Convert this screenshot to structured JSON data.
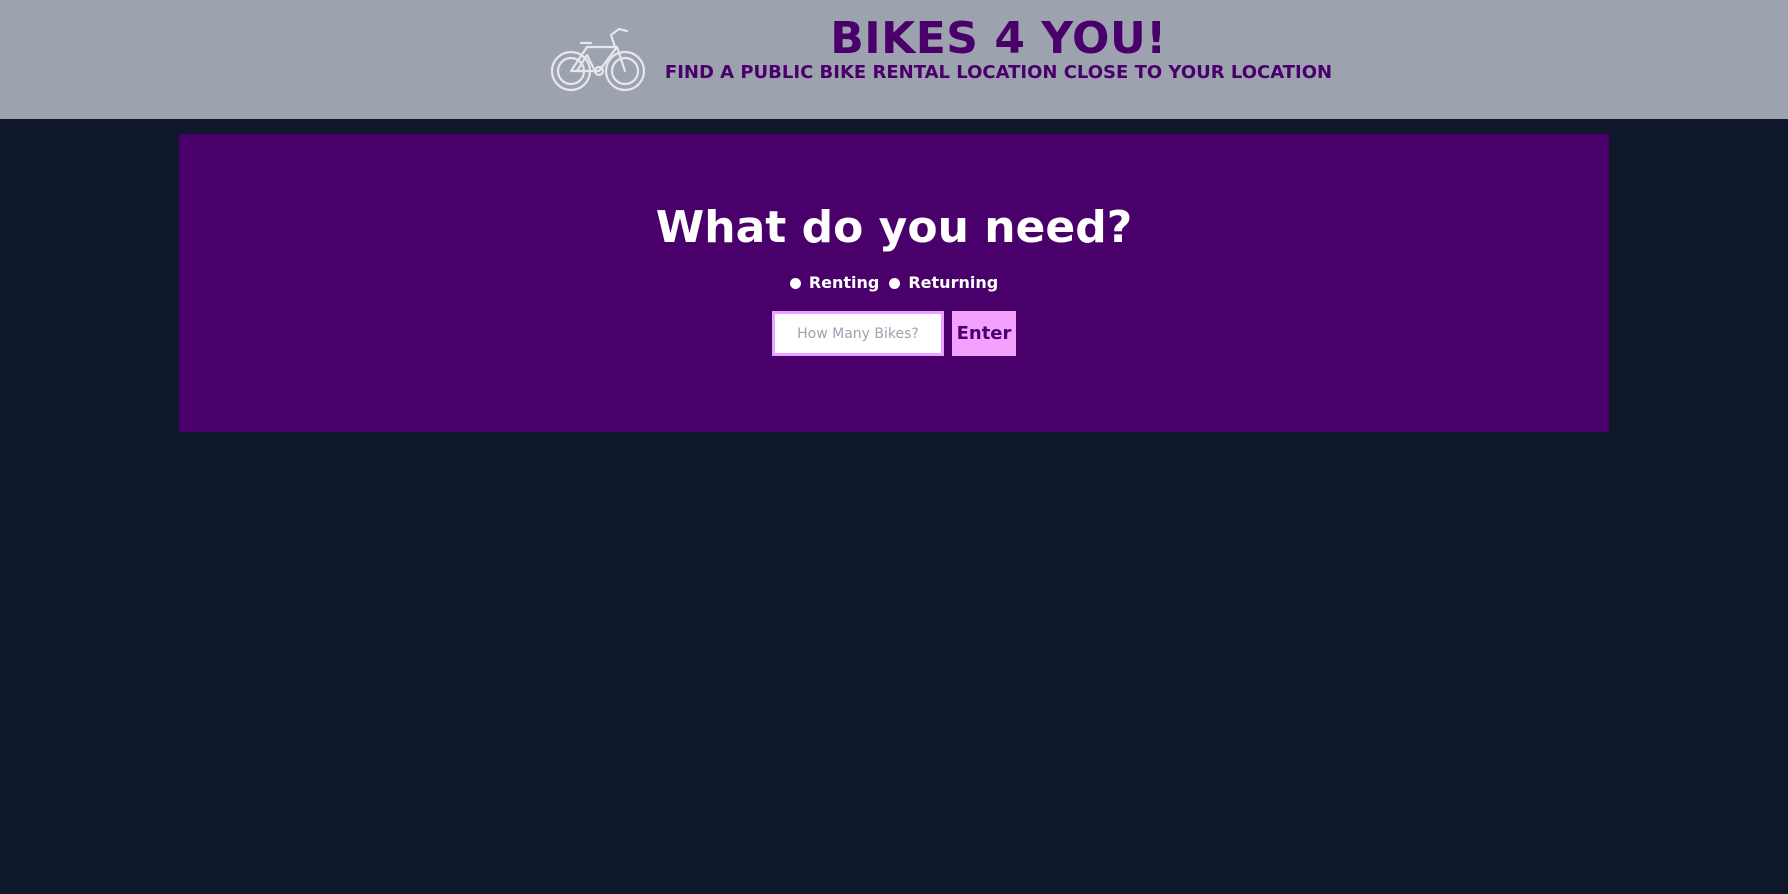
{
  "header": {
    "title": "BIKES 4 YOU!",
    "subtitle": "FIND A PUBLIC BIKE RENTAL LOCATION CLOSE TO YOUR LOCATION",
    "logo_icon": "bicycle-icon",
    "background": "#9ca3af",
    "text_color": "#4a006b"
  },
  "main": {
    "heading": "What do you need?",
    "options": [
      {
        "label": "Renting"
      },
      {
        "label": "Returning"
      }
    ],
    "input": {
      "placeholder": "How Many Bikes?",
      "value": ""
    },
    "submit_label": "Enter",
    "card_color": "#4a006b",
    "button_color": "#f3a0ff"
  },
  "page": {
    "background": "#0f172a"
  }
}
